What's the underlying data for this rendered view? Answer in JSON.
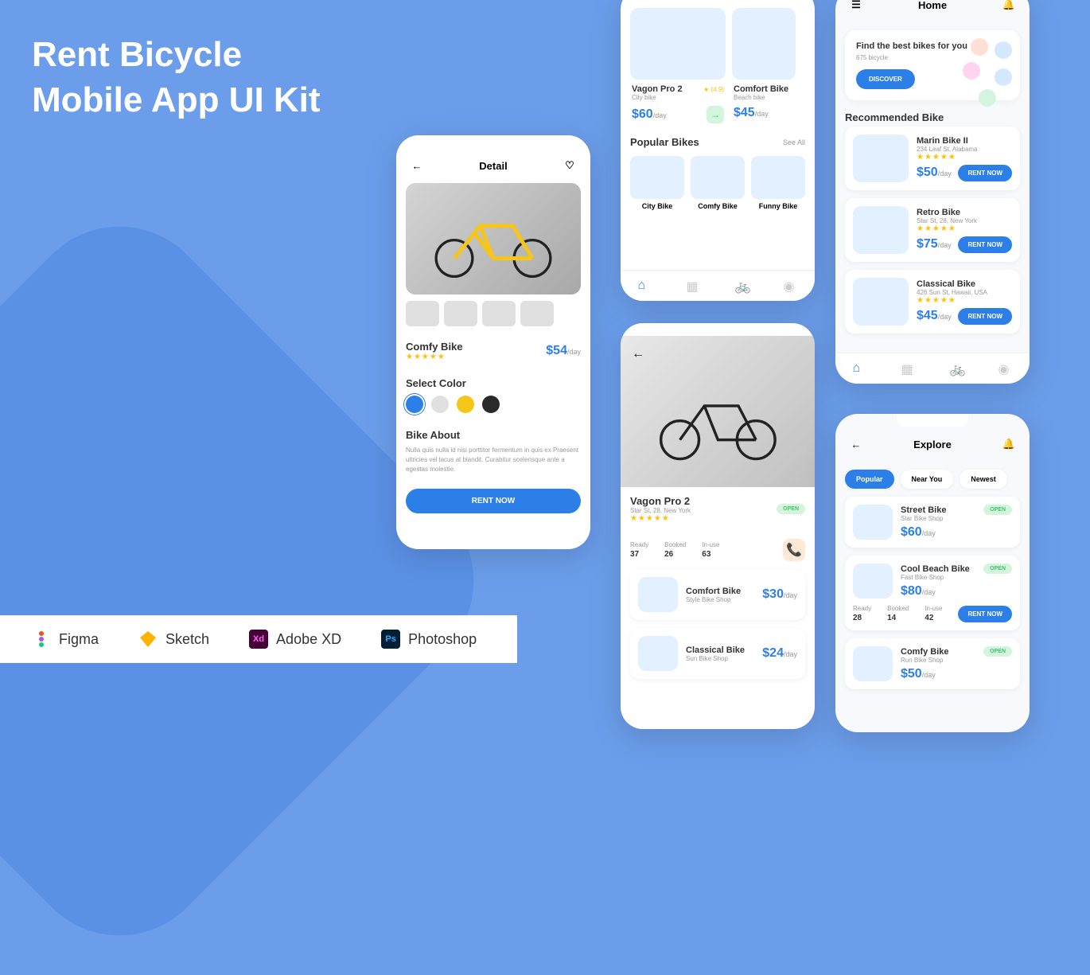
{
  "title": "Rent Bicycle\nMobile App UI Kit",
  "tools": [
    "Figma",
    "Sketch",
    "Adobe XD",
    "Photoshop"
  ],
  "detail": {
    "header": "Detail",
    "name": "Comfy Bike",
    "price": "$54",
    "unit": "/day",
    "select_color": "Select Color",
    "about_label": "Bike About",
    "about_text": "Nulla quis nulla id nisi porttitor fermentum in quis ex Praesent ultricies vel lacus at blandit. Curabitur scelerisque ante a egestas molestie.",
    "rent": "RENT NOW"
  },
  "list": {
    "featured": [
      {
        "name": "Vagon Pro 2",
        "sub": "City bike",
        "price": "$60",
        "unit": "/day",
        "rating": "(4.9)"
      },
      {
        "name": "Comfort Bike",
        "sub": "Beach bike",
        "price": "$45",
        "unit": "/day"
      }
    ],
    "popular_title": "Popular Bikes",
    "see_all": "See All",
    "categories": [
      "City Bike",
      "Comfy Bike",
      "Funny Bike"
    ]
  },
  "home": {
    "title": "Home",
    "hero_title": "Find the best bikes for you",
    "hero_sub": "675 bicycle",
    "discover": "DISCOVER",
    "rec_title": "Recommended Bike",
    "recs": [
      {
        "name": "Marin Bike II",
        "sub": "234 Leaf St, Alabama",
        "price": "$50",
        "unit": "/day"
      },
      {
        "name": "Retro Bike",
        "sub": "Star St, 28, New York",
        "price": "$75",
        "unit": "/day"
      },
      {
        "name": "Classical Bike",
        "sub": "426 Sun St, Hawaii, USA",
        "price": "$45",
        "unit": "/day"
      }
    ],
    "rent": "RENT NOW"
  },
  "shop": {
    "name": "Vagon Pro 2",
    "addr": "Star St, 28, New York",
    "status": "OPEN",
    "stats": [
      {
        "label": "Ready",
        "val": "37"
      },
      {
        "label": "Booked",
        "val": "26"
      },
      {
        "label": "In-use",
        "val": "63"
      }
    ],
    "bikes": [
      {
        "name": "Comfort Bike",
        "sub": "Style Bike Shop",
        "price": "$30",
        "unit": "/day"
      },
      {
        "name": "Classical Bike",
        "sub": "Sun Bike Shop",
        "price": "$24",
        "unit": "/day"
      }
    ]
  },
  "explore": {
    "title": "Explore",
    "pills": [
      "Popular",
      "Near You",
      "Newest"
    ],
    "items": [
      {
        "name": "Street Bike",
        "sub": "Star Bike Shop",
        "price": "$60",
        "unit": "/day",
        "status": "OPEN"
      },
      {
        "name": "Cool Beach Bike",
        "sub": "Fast Bike Shop",
        "price": "$80",
        "unit": "/day",
        "status": "OPEN",
        "stats": [
          {
            "label": "Ready",
            "val": "28"
          },
          {
            "label": "Booked",
            "val": "14"
          },
          {
            "label": "In-use",
            "val": "42"
          }
        ]
      },
      {
        "name": "Comfy Bike",
        "sub": "Run Bike Shop",
        "price": "$50",
        "unit": "/day",
        "status": "OPEN"
      }
    ],
    "rent": "RENT NOW"
  }
}
